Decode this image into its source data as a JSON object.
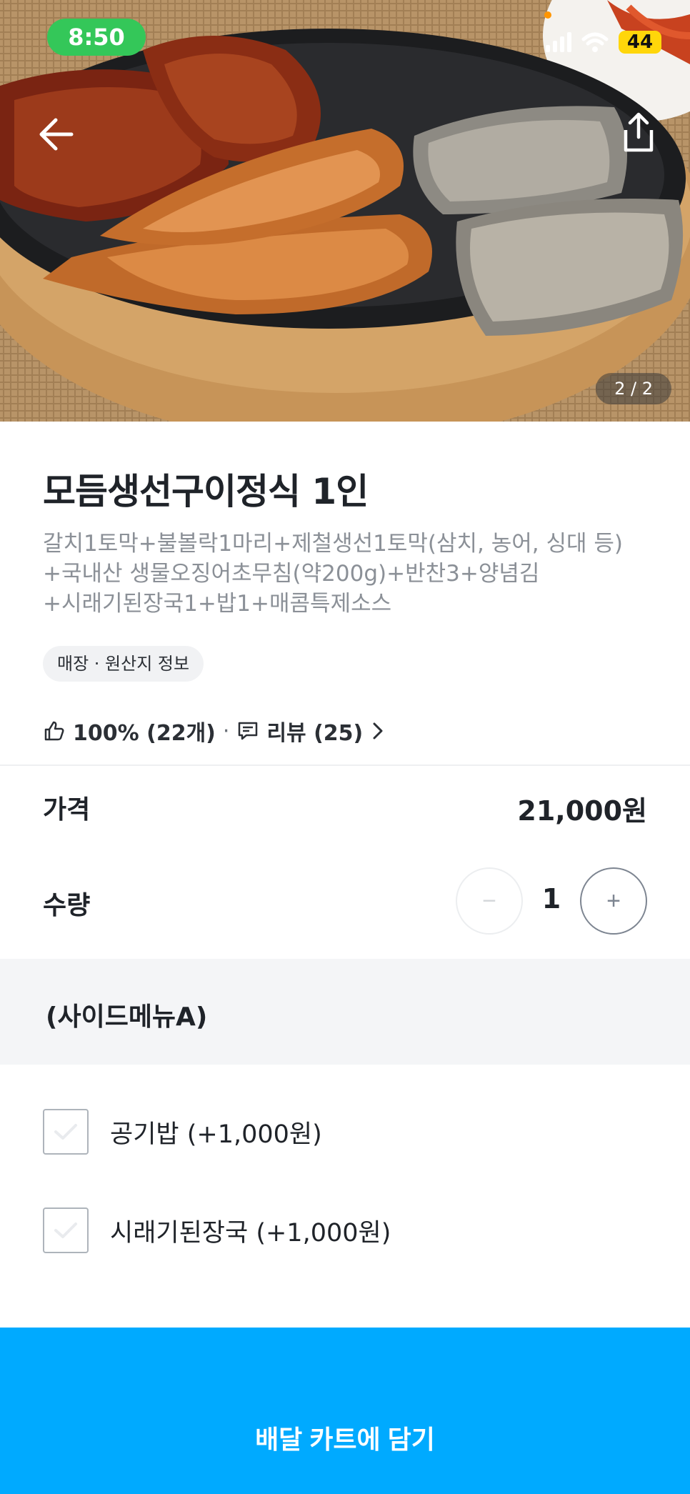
{
  "status_bar": {
    "time": "8:50",
    "battery": "44",
    "signal_icon": "cellular-signal-icon",
    "wifi_icon": "wifi-icon"
  },
  "hero": {
    "image_alt": "food-photo",
    "page_counter": "2 / 2",
    "back_icon": "back-arrow-icon",
    "share_icon": "share-icon"
  },
  "product": {
    "title": "모듬생선구이정식 1인",
    "description_lines": [
      "갈치1토막+불볼락1마리+제철생선1토막(삼치, 농어, 싱대 등)",
      "+국내산 생물오징어초무침(약200g)+반찬3+양념김",
      "+시래기된장국1+밥1+매콤특제소스"
    ],
    "origin_tag": "매장 · 원산지 정보",
    "rating": {
      "like_text": "100% (22개)",
      "separator": "·",
      "review_text": "리뷰 (25)"
    }
  },
  "price": {
    "label": "가격",
    "value": "21,000원"
  },
  "quantity": {
    "label": "수량",
    "value": "1",
    "minus": "−",
    "plus": "+"
  },
  "side_menu": {
    "title": "(사이드메뉴A)",
    "options": [
      {
        "label": "공기밥 (+1,000원)",
        "checked": false
      },
      {
        "label": "시래기된장국 (+1,000원)",
        "checked": false
      }
    ]
  },
  "cta": {
    "label": "배달 카트에 담기"
  },
  "colors": {
    "accent": "#00aaff",
    "time_pill": "#34c759",
    "battery": "#ffd60a",
    "text_primary": "#1f2329",
    "text_secondary": "#8b9097"
  }
}
